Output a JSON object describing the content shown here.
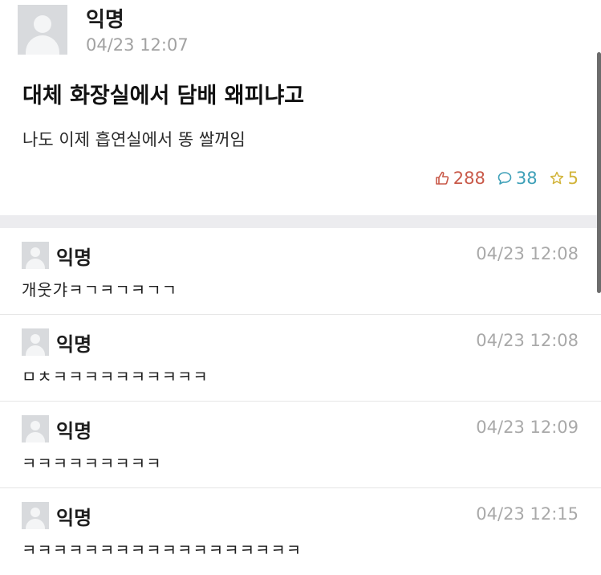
{
  "post": {
    "author": "익명",
    "time": "04/23 12:07",
    "title": "대체 화장실에서 담배 왜피냐고",
    "body": "나도 이제 흡연실에서 똥 쌀꺼임",
    "stats": {
      "likes": "288",
      "comments": "38",
      "scraps": "5",
      "like_icon": "thumbs-up-icon",
      "comment_icon": "speech-bubble-icon",
      "scrap_icon": "star-icon",
      "like_color": "#c95a4a",
      "comment_color": "#3ea0b8",
      "scrap_color": "#d2b43a"
    }
  },
  "comments": [
    {
      "author": "익명",
      "time": "04/23 12:08",
      "text": "개웃갸ㅋㄱㅋㄱㅋㄱㄱ"
    },
    {
      "author": "익명",
      "time": "04/23 12:08",
      "text": "ㅁㅊㅋㅋㅋㅋㅋㅋㅋㅋㅋㅋ"
    },
    {
      "author": "익명",
      "time": "04/23 12:09",
      "text": "ㅋㅋㅋㅋㅋㅋㅋㅋㅋ"
    },
    {
      "author": "익명",
      "time": "04/23 12:15",
      "text": "ㅋㅋㅋㅋㅋㅋㅋㅋㅋㅋㅋㅋㅋㅋㅋㅋㅋㅋ"
    }
  ]
}
